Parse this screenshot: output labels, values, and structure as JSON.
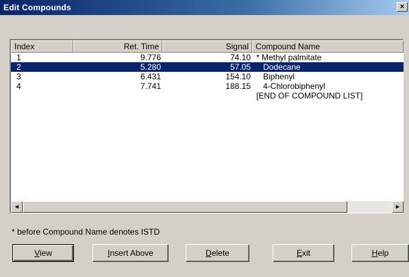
{
  "window": {
    "title": "Edit Compounds",
    "close_label": "×"
  },
  "table": {
    "columns": [
      "Index",
      "Ret. Time",
      "Signal",
      "Compound Name"
    ],
    "rows": [
      {
        "index": "1",
        "ret_time": "9.776",
        "signal": "74.10",
        "name": "* Methyl palmitate"
      },
      {
        "index": "2",
        "ret_time": "5.280",
        "signal": "57.05",
        "name": "Dodecane"
      },
      {
        "index": "3",
        "ret_time": "6.431",
        "signal": "154.10",
        "name": "Biphenyl"
      },
      {
        "index": "4",
        "ret_time": "7.741",
        "signal": "188.15",
        "name": "4-Chlorobiphenyl"
      },
      {
        "index": "",
        "ret_time": "",
        "signal": "",
        "name": "[END OF COMPOUND LIST]"
      }
    ],
    "selected_row": 1
  },
  "scrollbar": {
    "left_arrow": "◄",
    "right_arrow": "►"
  },
  "note": "* before Compound Name denotes ISTD",
  "buttons": {
    "view": {
      "accel": "V",
      "rest": "iew"
    },
    "insert": {
      "accel": "I",
      "rest": "nsert Above"
    },
    "delete": {
      "accel": "D",
      "rest": "elete"
    },
    "exit": {
      "accel": "E",
      "rest": "xit"
    },
    "help": {
      "accel": "H",
      "rest": "elp"
    }
  },
  "colors": {
    "selection": "#0a246a",
    "face": "#d4d0c8",
    "title_start": "#0a246a"
  }
}
